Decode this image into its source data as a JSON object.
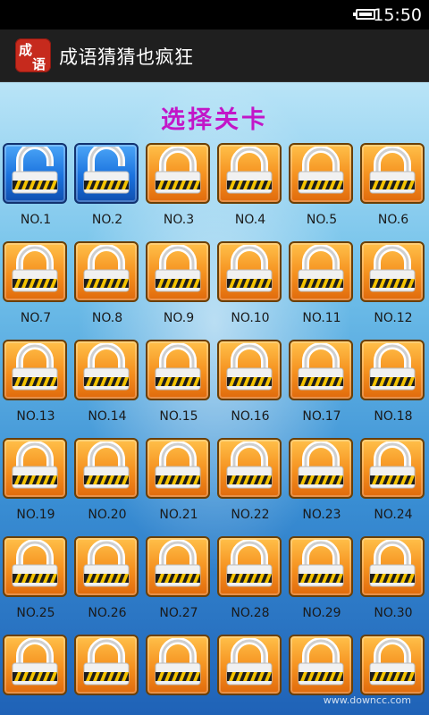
{
  "status_bar": {
    "time": "15:50",
    "battery_icon": "battery-icon"
  },
  "action_bar": {
    "app_icon_chars": [
      "成",
      "语"
    ],
    "title": "成语猜猜也疯狂"
  },
  "page": {
    "title": "选择关卡"
  },
  "levels": [
    {
      "label": "NO.1",
      "state": "unlocked"
    },
    {
      "label": "NO.2",
      "state": "unlocked"
    },
    {
      "label": "NO.3",
      "state": "locked"
    },
    {
      "label": "NO.4",
      "state": "locked"
    },
    {
      "label": "NO.5",
      "state": "locked"
    },
    {
      "label": "NO.6",
      "state": "locked"
    },
    {
      "label": "NO.7",
      "state": "locked"
    },
    {
      "label": "NO.8",
      "state": "locked"
    },
    {
      "label": "NO.9",
      "state": "locked"
    },
    {
      "label": "NO.10",
      "state": "locked"
    },
    {
      "label": "NO.11",
      "state": "locked"
    },
    {
      "label": "NO.12",
      "state": "locked"
    },
    {
      "label": "NO.13",
      "state": "locked"
    },
    {
      "label": "NO.14",
      "state": "locked"
    },
    {
      "label": "NO.15",
      "state": "locked"
    },
    {
      "label": "NO.16",
      "state": "locked"
    },
    {
      "label": "NO.17",
      "state": "locked"
    },
    {
      "label": "NO.18",
      "state": "locked"
    },
    {
      "label": "NO.19",
      "state": "locked"
    },
    {
      "label": "NO.20",
      "state": "locked"
    },
    {
      "label": "NO.21",
      "state": "locked"
    },
    {
      "label": "NO.22",
      "state": "locked"
    },
    {
      "label": "NO.23",
      "state": "locked"
    },
    {
      "label": "NO.24",
      "state": "locked"
    },
    {
      "label": "NO.25",
      "state": "locked"
    },
    {
      "label": "NO.26",
      "state": "locked"
    },
    {
      "label": "NO.27",
      "state": "locked"
    },
    {
      "label": "NO.28",
      "state": "locked"
    },
    {
      "label": "NO.29",
      "state": "locked"
    },
    {
      "label": "NO.30",
      "state": "locked"
    },
    {
      "label": "",
      "state": "locked"
    },
    {
      "label": "",
      "state": "locked"
    },
    {
      "label": "",
      "state": "locked"
    },
    {
      "label": "",
      "state": "locked"
    },
    {
      "label": "",
      "state": "locked"
    },
    {
      "label": "",
      "state": "locked"
    }
  ],
  "icons": {
    "locked": "padlock-locked-icon",
    "unlocked": "padlock-open-icon"
  },
  "colors": {
    "title": "#c216c8",
    "locked_tile": "#f5901e",
    "unlocked_tile": "#1a72de"
  },
  "watermark": "www.downcc.com"
}
